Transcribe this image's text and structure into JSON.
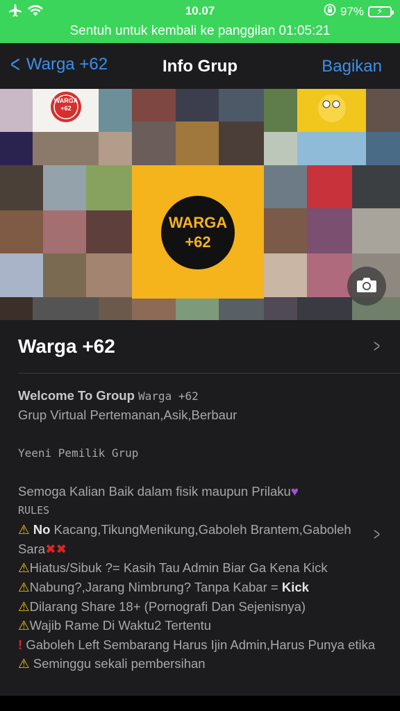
{
  "status_bar": {
    "time": "10.07",
    "battery": "97%",
    "airplane_icon": "airplane-icon",
    "wifi_icon": "wifi-icon",
    "lock_icon": "rotation-lock-icon"
  },
  "call_banner": "Sentuh untuk kembali ke panggilan 01:05:21",
  "nav": {
    "back_label": "Warga +62",
    "title": "Info Grup",
    "share_label": "Bagikan"
  },
  "group_photo": {
    "logo_line1": "WARGA",
    "logo_line2": "+62",
    "badge_line1": "WARGA",
    "badge_line2": "+62"
  },
  "group_name": "Warga +62",
  "description": {
    "l1_bold": "Welcome To Group",
    "l1_rest": "Warga +62",
    "l2": "Grup Virtual Pertemanan,Asik,Berbaur",
    "l3": "Yeeni Pemilik Grup",
    "l4": "Semoga Kalian Baik dalam fisik maupun Prilaku",
    "l5": "RULES",
    "r1_bold": "No",
    "r1_rest": "Kacang,TikungMenikung,Gaboleh Brantem,Gaboleh Sara",
    "r2": "Hiatus/Sibuk ?= Kasih Tau Admin Biar Ga Kena Kick",
    "r3_pre": "Nabung?,Jarang Nimbrung? Tanpa Kabar =",
    "r3_bold": "Kick",
    "r4": "Dilarang Share 18+ (Pornografi Dan Sejenisnya)",
    "r5": "Wajib Rame Di Waktu2 Tertentu",
    "r6": "Gaboleh Left Sembarang Harus Ijin Admin,Harus Punya etika",
    "r7": "Seminggu sekali pembersihan"
  },
  "colors": {
    "call_green": "#3ad55a",
    "ios_blue": "#3c8fe8",
    "logo_yellow": "#f5b31c",
    "panel_bg": "#1c1c1e"
  }
}
